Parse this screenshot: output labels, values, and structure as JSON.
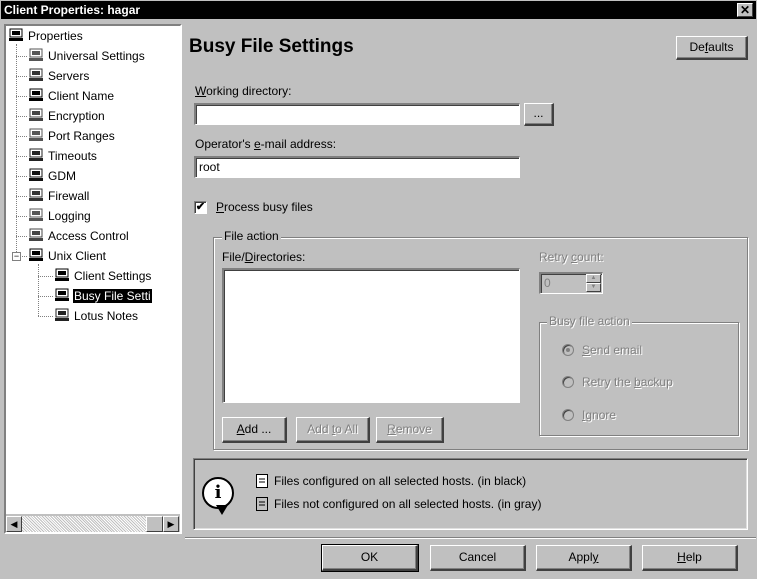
{
  "window": {
    "title": "Client Properties: hagar",
    "close_glyph": "✕"
  },
  "tree": {
    "items": [
      {
        "label": "Properties",
        "icon": "computer-icon"
      },
      {
        "label": "Universal Settings",
        "icon": "network-gear-icon"
      },
      {
        "label": "Servers",
        "icon": "server-icon"
      },
      {
        "label": "Client Name",
        "icon": "computer-icon"
      },
      {
        "label": "Encryption",
        "icon": "lock-icon"
      },
      {
        "label": "Port Ranges",
        "icon": "port-icon"
      },
      {
        "label": "Timeouts",
        "icon": "clock-icon"
      },
      {
        "label": "GDM",
        "icon": "gdm-icon"
      },
      {
        "label": "Firewall",
        "icon": "firewall-icon"
      },
      {
        "label": "Logging",
        "icon": "log-icon"
      },
      {
        "label": "Access Control",
        "icon": "access-control-icon"
      },
      {
        "label": "Unix Client",
        "icon": "computer-icon",
        "expander": "−"
      },
      {
        "label": "Client Settings",
        "icon": "computer-icon"
      },
      {
        "label": "Busy File Setti",
        "icon": "hourglass-file-icon",
        "selected": true
      },
      {
        "label": "Lotus Notes",
        "icon": "lotus-notes-icon"
      }
    ]
  },
  "main": {
    "heading": "Busy File Settings",
    "defaults_button": {
      "pre": "De",
      "accel": "f",
      "post": "aults"
    },
    "working_dir": {
      "label_accel": "W",
      "label_rest": "orking directory:",
      "value": "",
      "browse_label": "..."
    },
    "email": {
      "label_pre": "Operator's ",
      "label_accel": "e",
      "label_post": "-mail address:",
      "value": "root"
    },
    "process_busy": {
      "checked": "✔",
      "accel": "P",
      "rest": "rocess busy files"
    },
    "file_action": {
      "title": "File action",
      "list_label": {
        "pre": "File/",
        "accel": "D",
        "post": "irectories:"
      },
      "add": {
        "accel": "A",
        "post": "dd ..."
      },
      "add_to_all": {
        "pre": "Add ",
        "accel": "t",
        "post": "o All"
      },
      "remove": {
        "accel": "R",
        "post": "emove"
      },
      "retry_count": {
        "pre": "Retry ",
        "accel": "c",
        "post": "ount:",
        "value": "0"
      },
      "busy_action": {
        "title": "Busy file action",
        "options": [
          {
            "accel": "S",
            "post": "end email",
            "selected": true
          },
          {
            "pre": "Retry the ",
            "accel": "b",
            "post": "ackup",
            "selected": false
          },
          {
            "accel": "I",
            "post": "gnore",
            "selected": false
          }
        ]
      }
    },
    "info": {
      "icon_glyph": "i",
      "line1": "Files configured on all selected hosts. (in black)",
      "line2": "Files not configured on all selected hosts. (in gray)"
    }
  },
  "footer": {
    "ok": "OK",
    "cancel": "Cancel",
    "apply": {
      "pre": "Appl",
      "accel": "y"
    },
    "help": {
      "accel": "H",
      "post": "elp"
    }
  },
  "scrollbar": {
    "left_glyph": "◀",
    "right_glyph": "▶"
  }
}
